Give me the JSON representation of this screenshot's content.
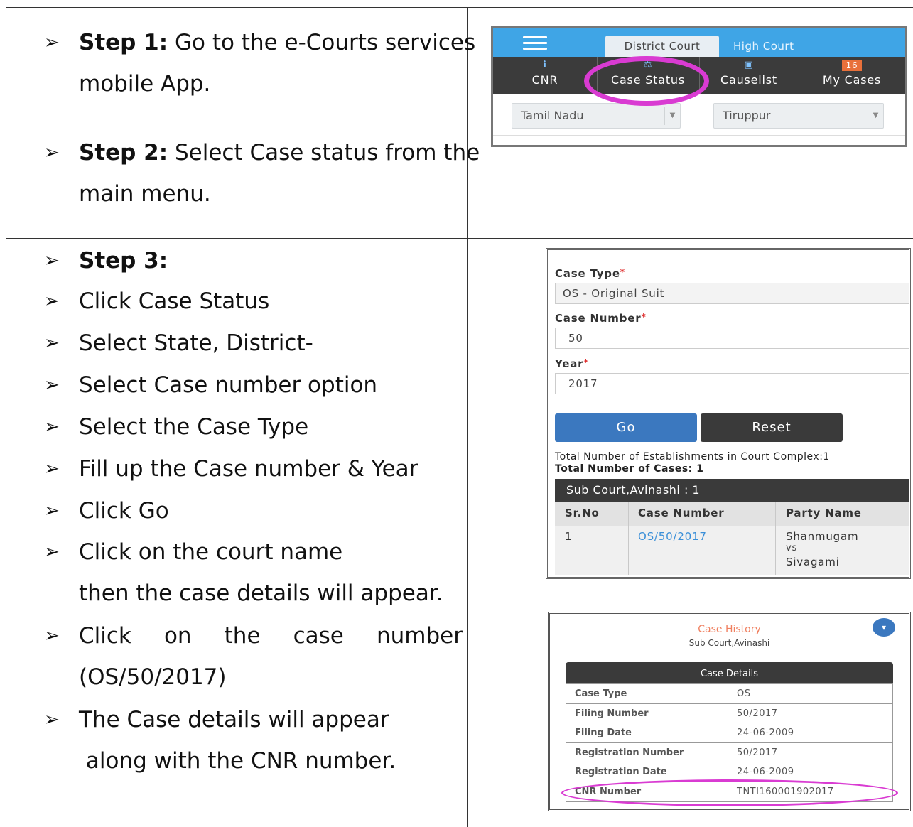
{
  "steps": {
    "step1_label": "Step 1:",
    "step1_text_a": " Go to the e-Courts services",
    "step1_text_b": "mobile App.",
    "step2_label": "Step 2:",
    "step2_text_a": " Select Case status from the",
    "step2_text_b": "main menu.",
    "step3_label": "Step 3:",
    "items": [
      "Click Case Status",
      "Select State, District-",
      "Select Case number option",
      "Select the Case Type",
      "Fill up the Case number & Year",
      "Click Go",
      "Click on the court name"
    ],
    "court_cont": "then the case details will appear.",
    "click_words": [
      "Click",
      "on",
      "the",
      "case",
      "number"
    ],
    "click_cont": "(OS/50/2017)",
    "last_a": "The Case details will appear",
    "last_b": " along with the CNR number."
  },
  "app_home": {
    "tab_district": "District Court",
    "tab_high": "High Court",
    "nav_cnr": "CNR",
    "nav_case_status": "Case Status",
    "nav_causelist": "Causelist",
    "nav_my_cases": "My Cases",
    "my_cases_badge": "16",
    "state_select": "Tamil Nadu",
    "district_select": "Tiruppur",
    "highlight_color": "#d93bd2",
    "nav_bg": "#3b3b3b",
    "top_bg": "#3fa5e6"
  },
  "case_form": {
    "case_type_label": "Case Type",
    "case_type_value": "OS - Original Suit",
    "case_number_label": "Case Number",
    "case_number_value": "50",
    "year_label": "Year",
    "year_value": "2017",
    "go_label": "Go",
    "reset_label": "Reset",
    "total_establishments": "Total Number of Establishments in Court Complex:1",
    "total_cases": "Total Number of Cases: 1",
    "court_name": "Sub Court,Avinashi : 1",
    "col_srno": "Sr.No",
    "col_case_number": "Case Number",
    "col_party_name": "Party Name",
    "row_srno": "1",
    "row_case_number": "OS/50/2017",
    "row_party_1": "Shanmugam",
    "row_party_vs": "vs",
    "row_party_2": "Sivagami",
    "go_color": "#3b78bf"
  },
  "case_history": {
    "title": "Case History",
    "court": "Sub Court,Avinashi",
    "details_header": "Case Details",
    "rows": [
      {
        "key": "Case Type",
        "value": "OS"
      },
      {
        "key": "Filing Number",
        "value": "50/2017"
      },
      {
        "key": "Filing Date",
        "value": "24-06-2009"
      },
      {
        "key": "Registration Number",
        "value": "50/2017"
      },
      {
        "key": "Registration Date",
        "value": "24-06-2009"
      },
      {
        "key": "CNR Number",
        "value": "TNTI160001902017"
      }
    ]
  }
}
